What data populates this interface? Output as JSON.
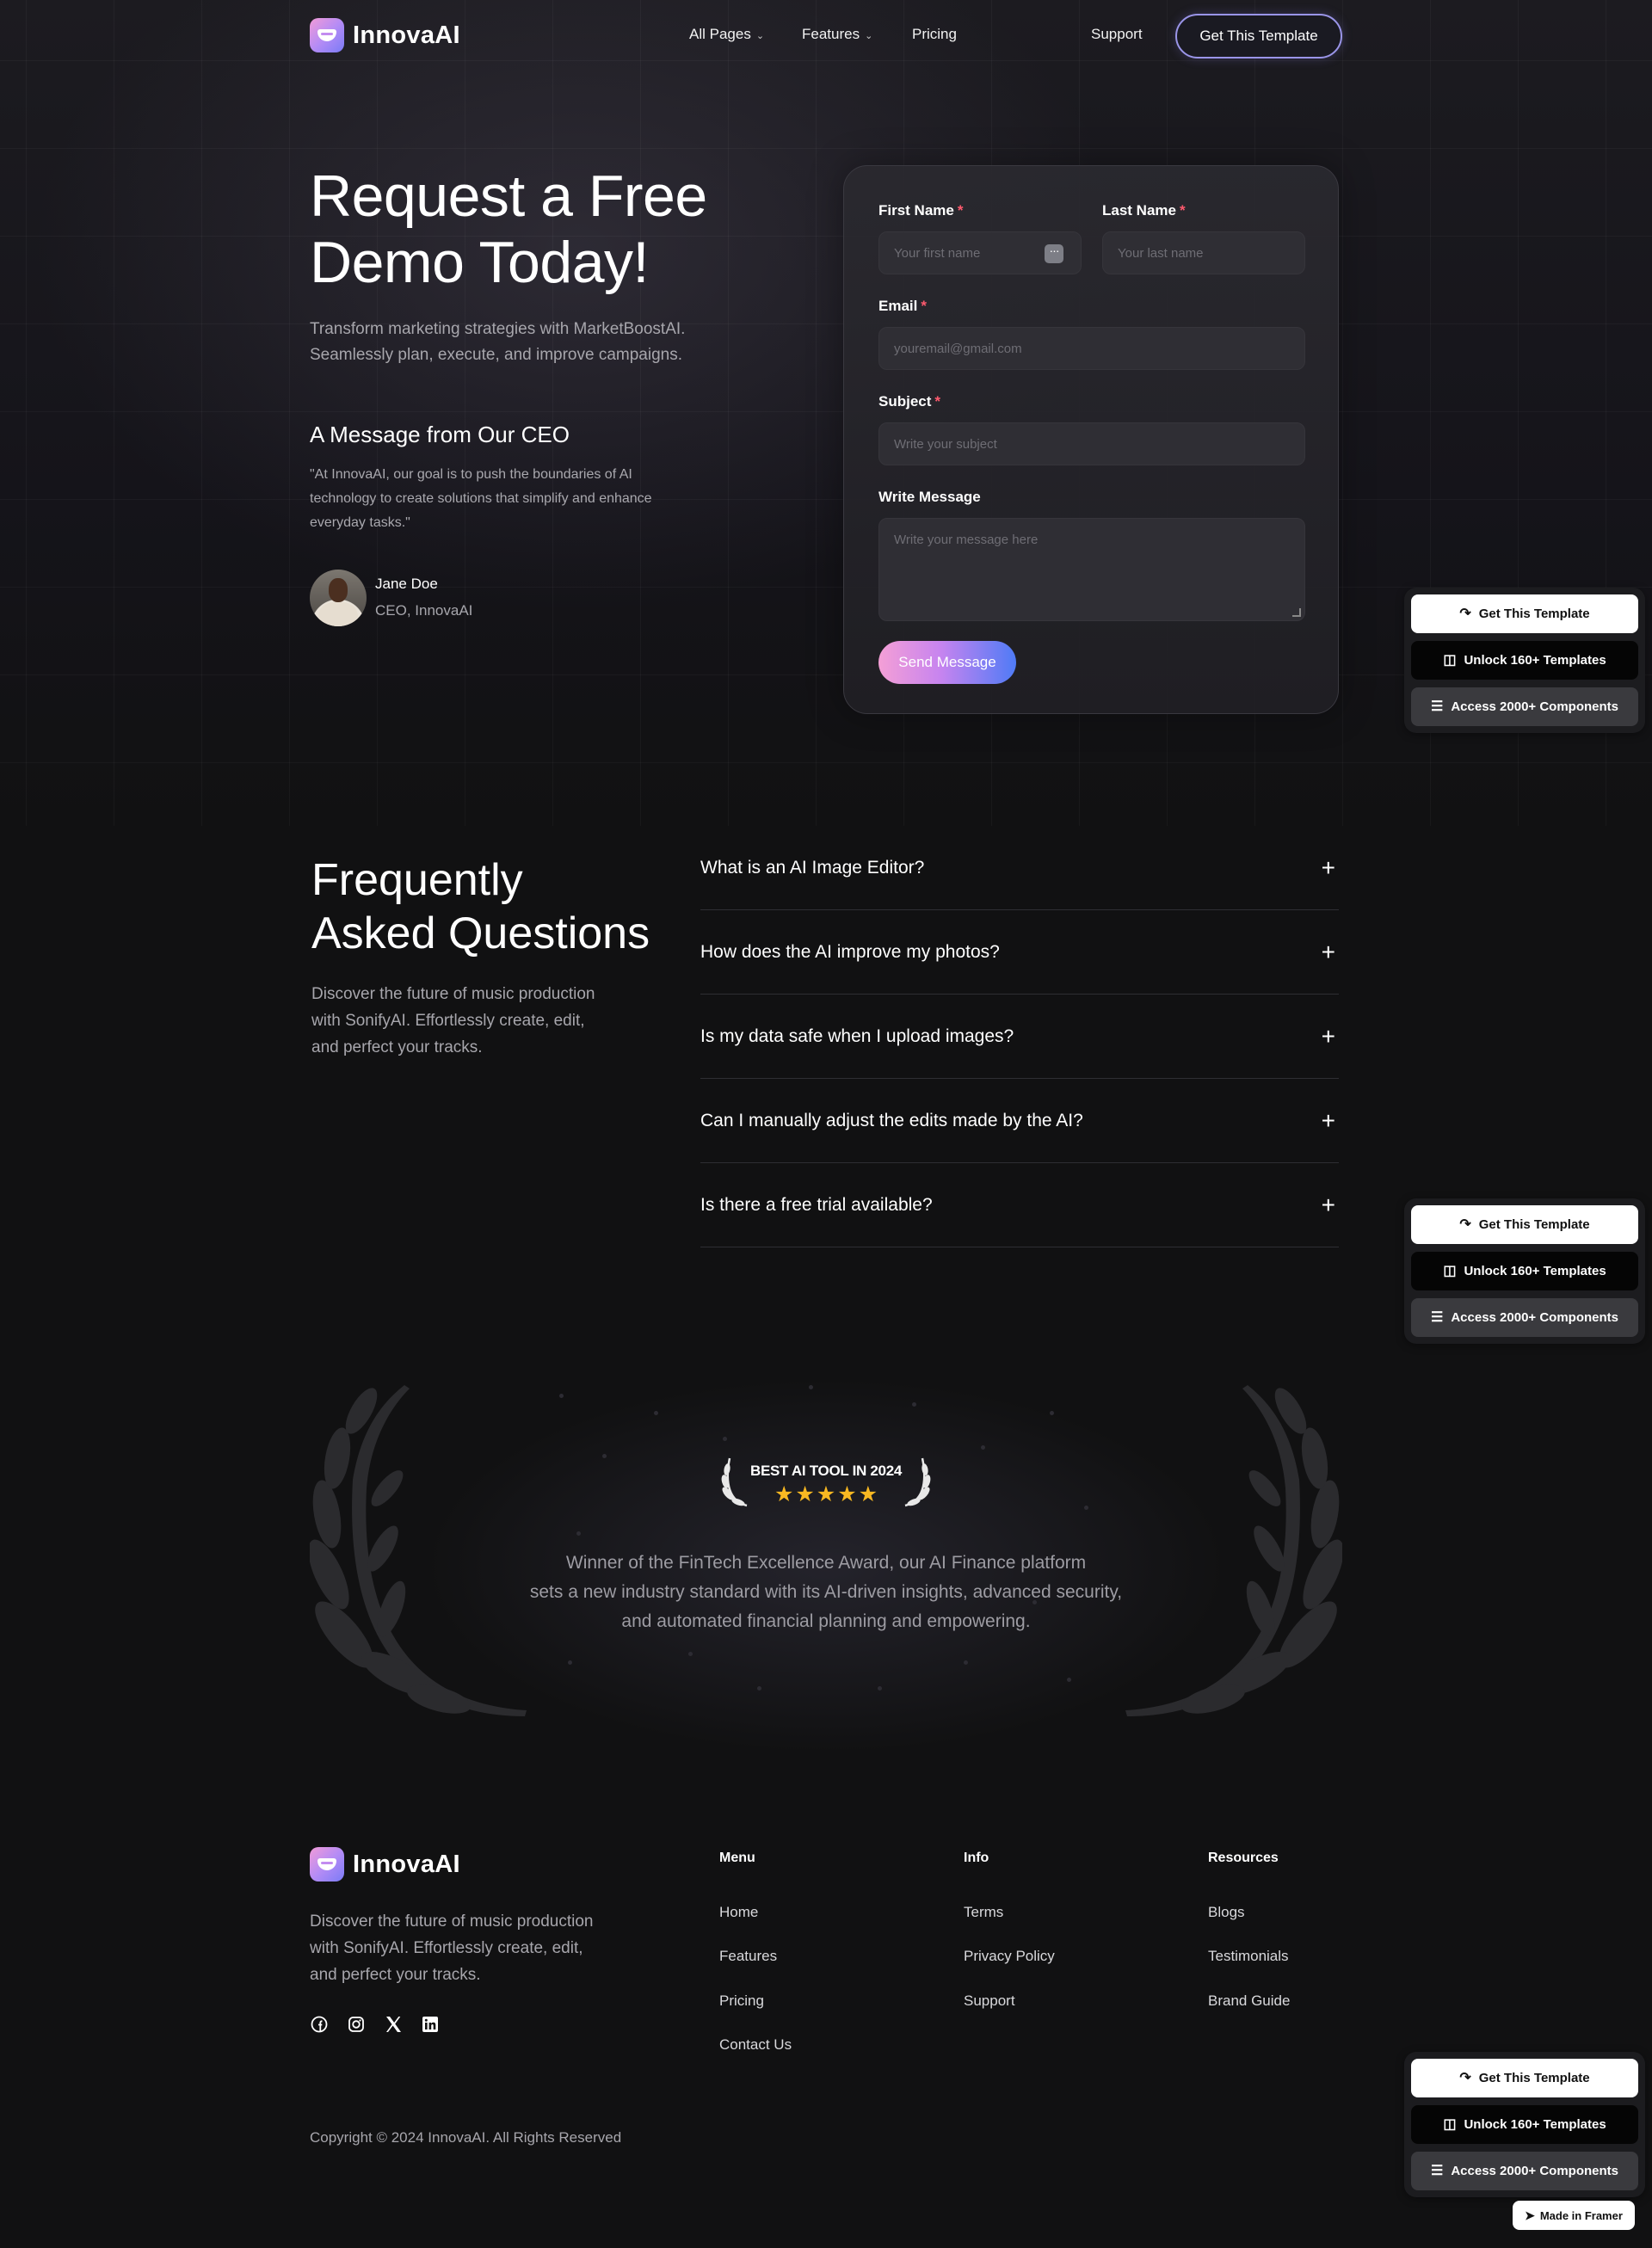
{
  "nav": {
    "brand": "InnovaAI",
    "links": [
      "All Pages",
      "Features",
      "Pricing"
    ],
    "support": "Support",
    "cta": "Get This Template"
  },
  "hero": {
    "title_line1": "Request a Free",
    "title_line2": "Demo Today!",
    "subtitle_line1": "Transform marketing strategies with MarketBoostAI.",
    "subtitle_line2": "Seamlessly plan, execute, and improve campaigns.",
    "ceo_heading": "A Message from Our CEO",
    "ceo_quote_line1": "\"At InnovaAI, our goal is to push the boundaries of AI",
    "ceo_quote_line2": "technology to create solutions that simplify and enhance",
    "ceo_quote_line3": "everyday tasks.\"",
    "ceo_name": "Jane Doe",
    "ceo_role": "CEO, InnovaAI"
  },
  "form": {
    "first_name_label": "First Name",
    "first_name_placeholder": "Your first name",
    "last_name_label": "Last Name",
    "last_name_placeholder": "Your last name",
    "email_label": "Email",
    "email_placeholder": "youremail@gmail.com",
    "subject_label": "Subject",
    "subject_placeholder": "Write your subject",
    "message_label": "Write Message",
    "message_placeholder": "Write your message here",
    "required_mark": "*",
    "submit": "Send Message"
  },
  "promo": {
    "get_template": "Get This Template",
    "unlock": "Unlock 160+ Templates",
    "access": "Access 2000+ Components"
  },
  "faq": {
    "title_line1": "Frequently",
    "title_line2": "Asked Questions",
    "sub_line1": "Discover the future of music production",
    "sub_line2": "with SonifyAI. Effortlessly create, edit,",
    "sub_line3": "and perfect your tracks.",
    "items": [
      "What is an AI Image Editor?",
      "How does the AI improve my photos?",
      "Is my data safe when I upload images?",
      "Can I manually adjust the edits made by the AI?",
      "Is there a free trial available?"
    ]
  },
  "award": {
    "badge": "BEST AI TOOL IN 2024",
    "stars": 5,
    "text_line1": "Winner of the FinTech Excellence Award, our AI Finance platform",
    "text_line2": "sets a new industry standard with its AI-driven insights, advanced security,",
    "text_line3": "and automated financial planning and empowering."
  },
  "footer": {
    "brand": "InnovaAI",
    "desc_line1": "Discover the future of music production",
    "desc_line2": "with SonifyAI. Effortlessly create, edit,",
    "desc_line3": "and perfect your tracks.",
    "menu_heading": "Menu",
    "menu": [
      "Home",
      "Features",
      "Pricing",
      "Contact Us"
    ],
    "info_heading": "Info",
    "info": [
      "Terms",
      "Privacy Policy",
      "Support"
    ],
    "resources_heading": "Resources",
    "resources": [
      "Blogs",
      "Testimonials",
      "Brand Guide"
    ],
    "socials": [
      "facebook-icon",
      "instagram-icon",
      "x-icon",
      "linkedin-icon"
    ],
    "copyright": "Copyright © 2024 InnovaAI. All Rights Reserved",
    "framer_badge": "Made in Framer"
  },
  "colors": {
    "background": "#111112",
    "accent_gradient_start": "#f49fd6",
    "accent_gradient_end": "#4f7bf6",
    "required": "#ff5a6e",
    "star": "#f8b822"
  }
}
